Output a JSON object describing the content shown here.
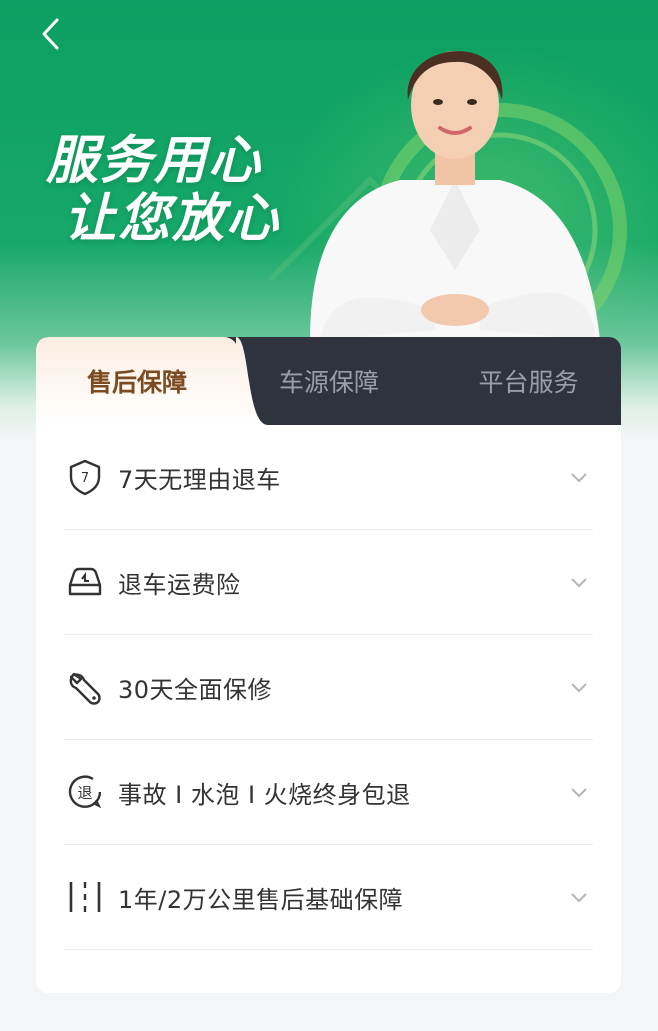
{
  "header": {
    "back_icon": "chevron-left-icon",
    "headline_line1": "服务用心",
    "headline_line2": "让您放心"
  },
  "tabs": [
    {
      "label": "售后保障",
      "active": true
    },
    {
      "label": "车源保障",
      "active": false
    },
    {
      "label": "平台服务",
      "active": false
    }
  ],
  "items": [
    {
      "icon": "shield-7-icon",
      "icon_text": "7",
      "label": "7天无理由退车"
    },
    {
      "icon": "car-icon",
      "label": "退车运费险"
    },
    {
      "icon": "wrench-icon",
      "label": "30天全面保修"
    },
    {
      "icon": "return-icon",
      "icon_text": "退",
      "label": "事故 I 水泡 I 火烧终身包退"
    },
    {
      "icon": "road-icon",
      "label": "1年/2万公里售后基础保障"
    }
  ],
  "colors": {
    "brand_green": "#0ba061",
    "tab_bar": "#2f333d",
    "active_tab_text": "#7a4b20"
  }
}
